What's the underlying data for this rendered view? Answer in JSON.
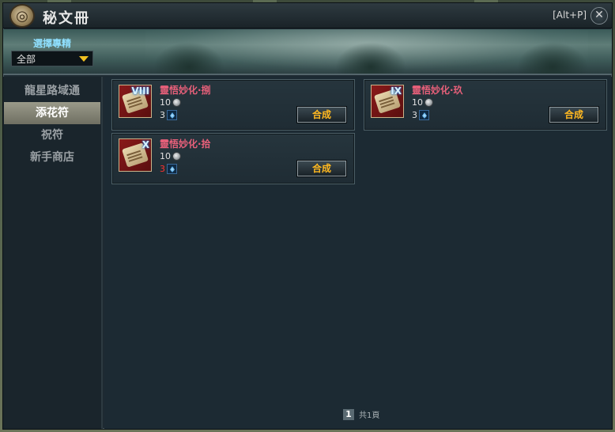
{
  "window": {
    "title": "秘文冊",
    "hotkey": "[Alt+P]",
    "close_glyph": "✕",
    "emblem_glyph": "◎"
  },
  "filter": {
    "label": "選擇專精",
    "selected": "全部"
  },
  "sidebar": {
    "items": [
      {
        "label": "龍星路域通",
        "active": false
      },
      {
        "label": "添花符",
        "active": true
      },
      {
        "label": "祝符",
        "active": false
      },
      {
        "label": "新手商店",
        "active": false
      }
    ]
  },
  "recipes": [
    {
      "name": "靈悟妙化·捌",
      "numeral": "VIII",
      "coin_cost": "10",
      "crystal_cost": "3",
      "crystal_insufficient": false,
      "button": "合成"
    },
    {
      "name": "靈悟妙化·玖",
      "numeral": "IX",
      "coin_cost": "10",
      "crystal_cost": "3",
      "crystal_insufficient": false,
      "button": "合成"
    },
    {
      "name": "靈悟妙化·拾",
      "numeral": "X",
      "coin_cost": "10",
      "crystal_cost": "3",
      "crystal_insufficient": true,
      "button": "合成"
    }
  ],
  "pagination": {
    "current": "1",
    "total_text": "共1頁"
  },
  "colors": {
    "item_name": "#e8607a",
    "button_text": "#ffb820",
    "insufficient": "#ff3030",
    "filter_label": "#8fe0ff"
  }
}
